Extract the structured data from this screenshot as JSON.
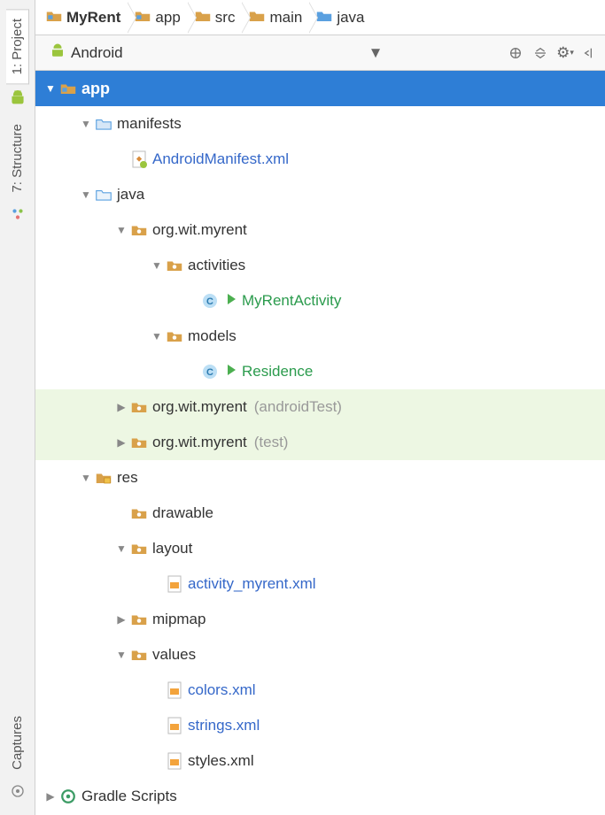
{
  "breadcrumb": [
    {
      "label": "MyRent",
      "icon": "module-folder"
    },
    {
      "label": "app",
      "icon": "module-folder"
    },
    {
      "label": "src",
      "icon": "folder"
    },
    {
      "label": "main",
      "icon": "folder"
    },
    {
      "label": "java",
      "icon": "source-folder"
    }
  ],
  "left_tabs": {
    "project": "1: Project",
    "structure": "7: Structure",
    "captures": "Captures"
  },
  "toolbar": {
    "view_label": "Android"
  },
  "tree": {
    "app": "app",
    "manifests": "manifests",
    "android_manifest": "AndroidManifest.xml",
    "java": "java",
    "pkg_main": "org.wit.myrent",
    "activities": "activities",
    "myrent_activity": "MyRentActivity",
    "models": "models",
    "residence": "Residence",
    "pkg_androidtest": "org.wit.myrent",
    "pkg_androidtest_suffix": "(androidTest)",
    "pkg_test": "org.wit.myrent",
    "pkg_test_suffix": "(test)",
    "res": "res",
    "drawable": "drawable",
    "layout": "layout",
    "activity_myrent_xml": "activity_myrent.xml",
    "mipmap": "mipmap",
    "values": "values",
    "colors_xml": "colors.xml",
    "strings_xml": "strings.xml",
    "styles_xml": "styles.xml",
    "gradle_scripts": "Gradle Scripts"
  }
}
